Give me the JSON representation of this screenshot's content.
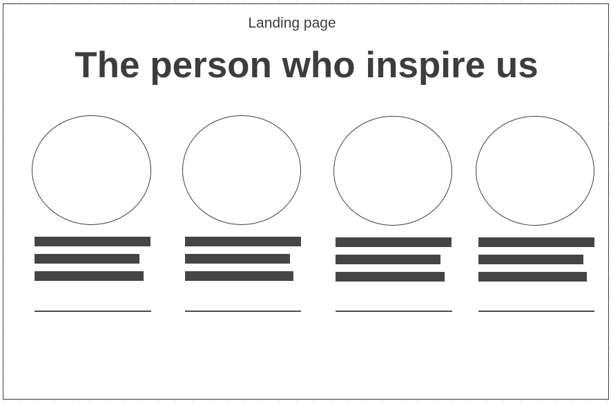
{
  "header": {
    "page_label": "Landing page",
    "headline": "The person who inspire us"
  },
  "profiles": [
    {
      "text_lines": 3,
      "has_underline": true
    },
    {
      "text_lines": 3,
      "has_underline": true
    },
    {
      "text_lines": 3,
      "has_underline": true
    },
    {
      "text_lines": 3,
      "has_underline": true
    }
  ],
  "colors": {
    "text": "#3d3d3d",
    "placeholder_bar": "#454545",
    "frame_border": "#3d3d3d",
    "grid_line": "#ececec",
    "background": "#ffffff"
  }
}
